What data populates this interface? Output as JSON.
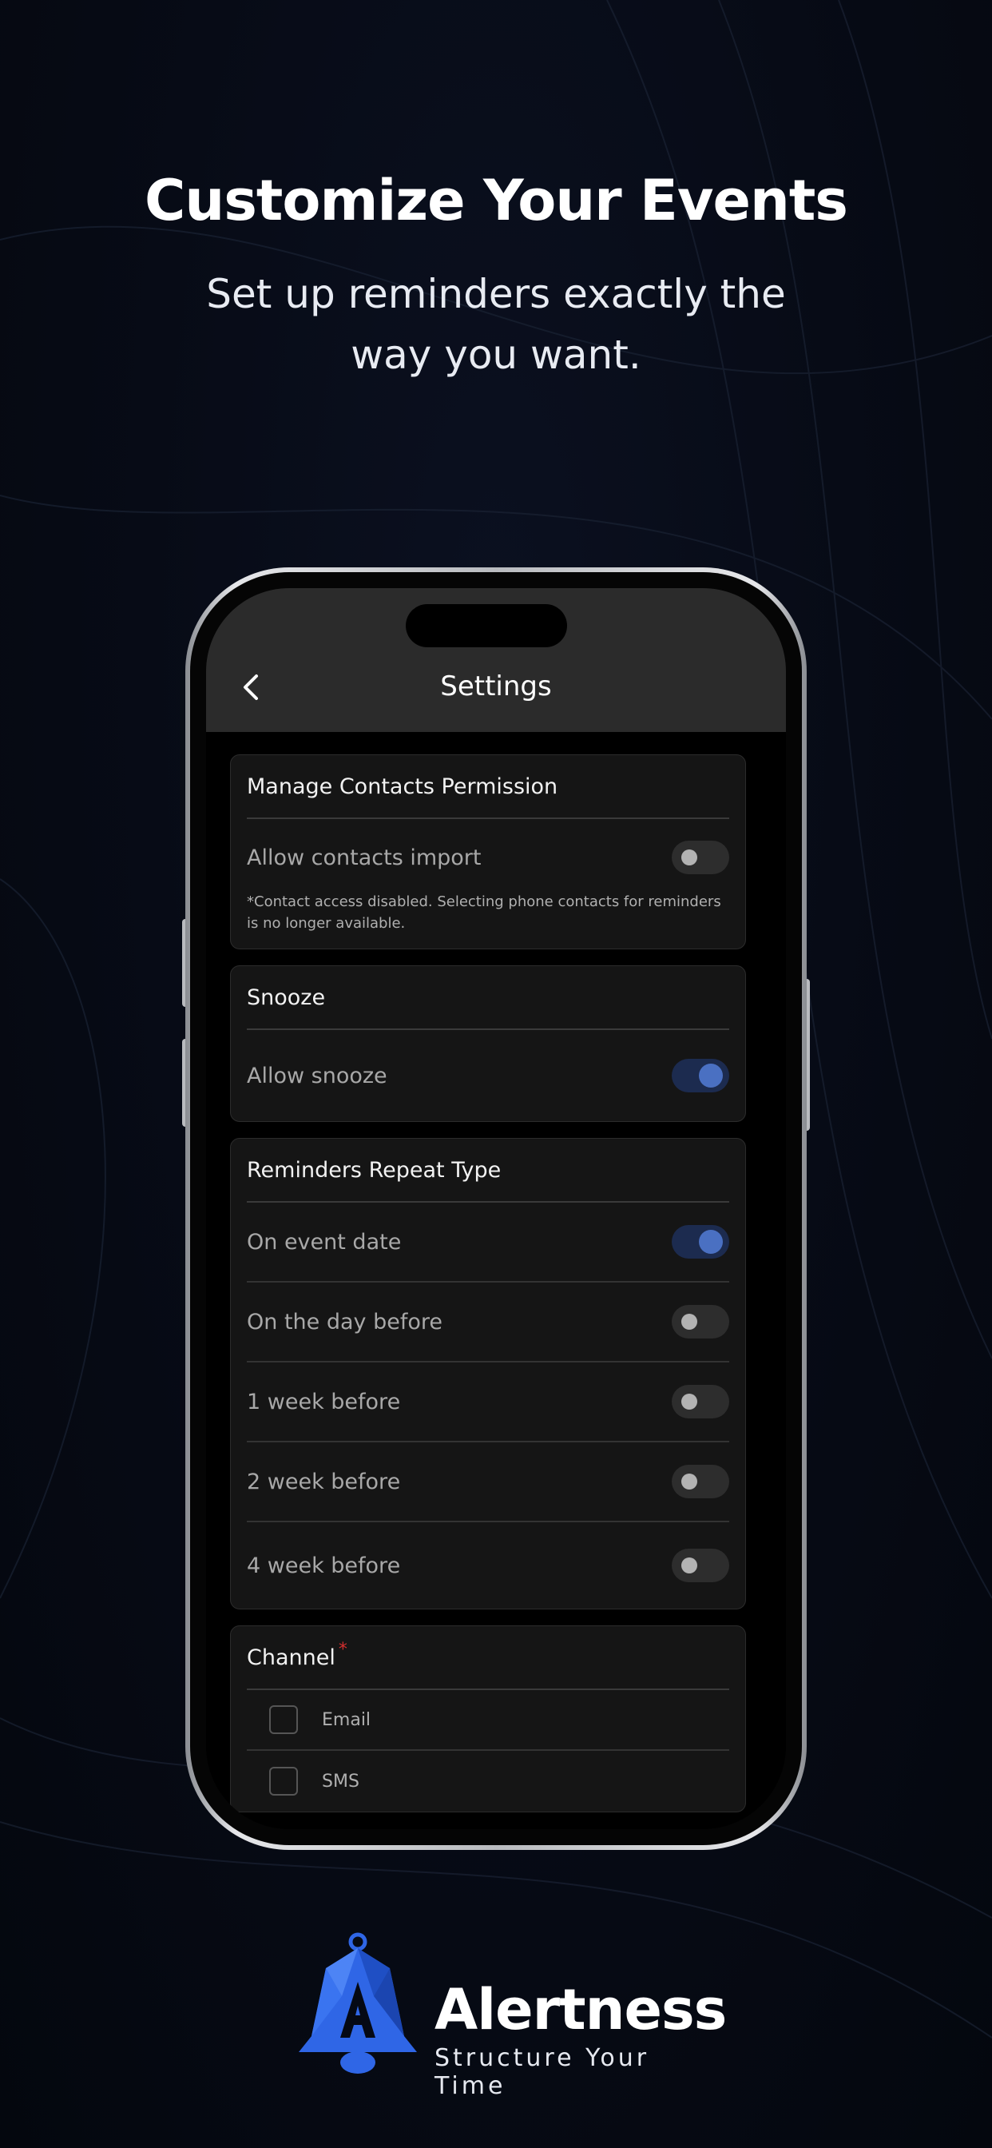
{
  "hero": {
    "title": "Customize Your Events",
    "subtitle": "Set up reminders exactly the way you want."
  },
  "screen": {
    "title": "Settings",
    "back_icon": "chevron-left-icon"
  },
  "contacts_card": {
    "title": "Manage Contacts Permission",
    "row_label": "Allow contacts import",
    "toggle_on": false,
    "note": "*Contact access disabled. Selecting phone contacts for reminders is no longer available."
  },
  "snooze_card": {
    "title": "Snooze",
    "row_label": "Allow snooze",
    "toggle_on": true
  },
  "repeat_card": {
    "title": "Reminders Repeat Type",
    "rows": [
      {
        "label": "On event date",
        "on": true
      },
      {
        "label": "On the day before",
        "on": false
      },
      {
        "label": "1 week before",
        "on": false
      },
      {
        "label": "2 week before",
        "on": false
      },
      {
        "label": "4 week before",
        "on": false
      }
    ]
  },
  "channel_card": {
    "title": "Channel",
    "required_mark": "*",
    "options": [
      {
        "label": "Email",
        "checked": false
      },
      {
        "label": "SMS",
        "checked": false
      }
    ]
  },
  "brand": {
    "name": "Alertness",
    "tagline": "Structure Your Time",
    "logo_icon": "bell-a-logo-icon"
  },
  "colors": {
    "accent": "#4a70c2",
    "required": "#d32f2f",
    "logo_blue": "#2f66e6"
  }
}
